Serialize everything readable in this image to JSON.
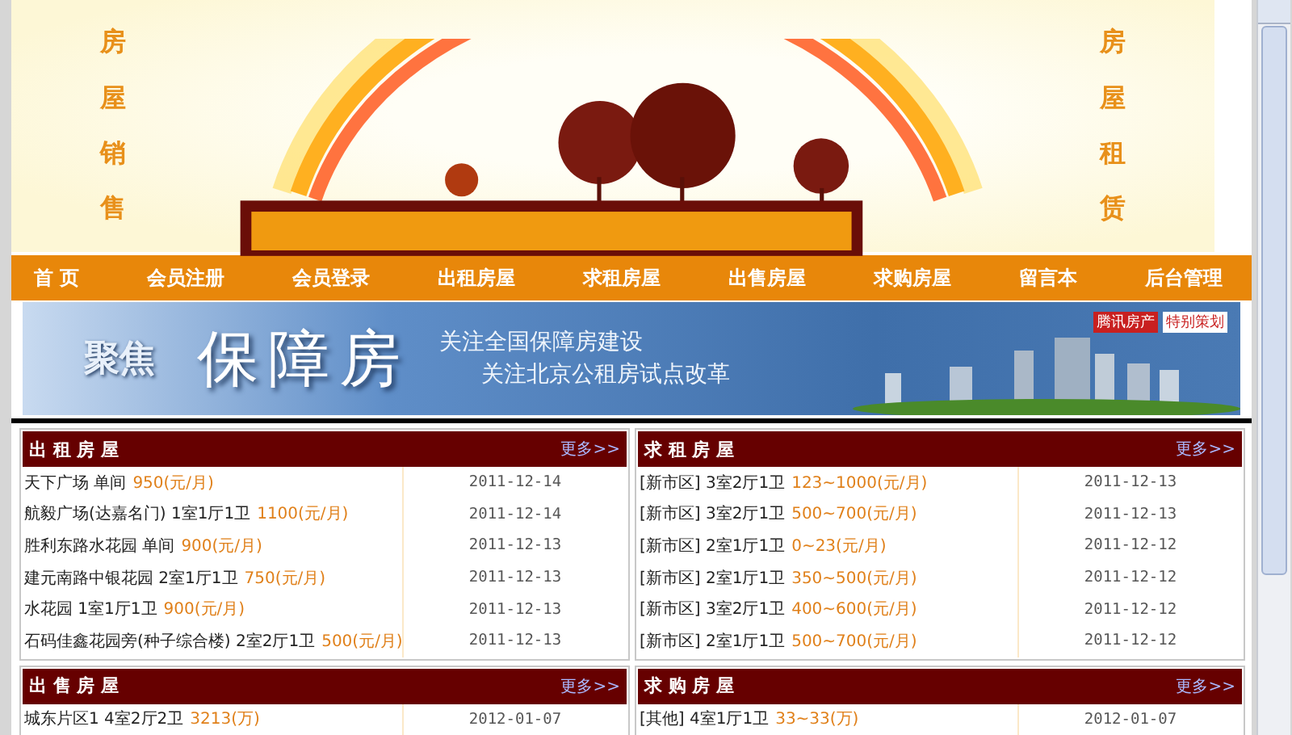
{
  "header": {
    "left_caption": "房屋销售",
    "right_caption": "房屋租赁"
  },
  "nav": [
    {
      "label": "首 页"
    },
    {
      "label": "会员注册"
    },
    {
      "label": "会员登录"
    },
    {
      "label": "出租房屋"
    },
    {
      "label": "求租房屋"
    },
    {
      "label": "出售房屋"
    },
    {
      "label": "求购房屋"
    },
    {
      "label": "留言本"
    },
    {
      "label": "后台管理"
    }
  ],
  "banner": {
    "focus": "聚焦",
    "title": "保障房",
    "line_1": "关注全国保障房建设",
    "line_2": "关注北京公租房试点改革",
    "tag_1": "腾讯房产",
    "tag_2": "特别策划"
  },
  "panels": [
    {
      "title": "出 租 房 屋",
      "more": "更多>>",
      "rows": [
        {
          "text": "天下广场 单间",
          "price": "950(元/月)",
          "date": "2011-12-14"
        },
        {
          "text": "航毅广场(达嘉名门) 1室1厅1卫",
          "price": "1100(元/月)",
          "date": "2011-12-14"
        },
        {
          "text": "胜利东路水花园 单间",
          "price": "900(元/月)",
          "date": "2011-12-13"
        },
        {
          "text": "建元南路中银花园 2室1厅1卫",
          "price": "750(元/月)",
          "date": "2011-12-13"
        },
        {
          "text": "水花园 1室1厅1卫",
          "price": "900(元/月)",
          "date": "2011-12-13"
        },
        {
          "text": "石码佳鑫花园旁(种子综合楼) 2室2厅1卫",
          "price": "500(元/月)",
          "date": "2011-12-13"
        }
      ]
    },
    {
      "title": "求 租 房 屋",
      "more": "更多>>",
      "rows": [
        {
          "text": "[新市区] 3室2厅1卫",
          "price": "123~1000(元/月)",
          "date": "2011-12-13"
        },
        {
          "text": "[新市区] 3室2厅1卫",
          "price": "500~700(元/月)",
          "date": "2011-12-13"
        },
        {
          "text": "[新市区] 2室1厅1卫",
          "price": "0~23(元/月)",
          "date": "2011-12-12"
        },
        {
          "text": "[新市区] 2室1厅1卫",
          "price": "350~500(元/月)",
          "date": "2011-12-12"
        },
        {
          "text": "[新市区] 3室2厅1卫",
          "price": "400~600(元/月)",
          "date": "2011-12-12"
        },
        {
          "text": "[新市区] 2室1厅1卫",
          "price": "500~700(元/月)",
          "date": "2011-12-12"
        }
      ]
    },
    {
      "title": "出 售 房 屋",
      "more": "更多>>",
      "rows": [
        {
          "text": "城东片区1 4室2厅2卫",
          "price": "3213(万)",
          "date": "2012-01-07"
        }
      ]
    },
    {
      "title": "求 购 房 屋",
      "more": "更多>>",
      "rows": [
        {
          "text": "[其他] 4室1厅1卫",
          "price": "33~33(万)",
          "date": "2012-01-07"
        }
      ]
    }
  ]
}
